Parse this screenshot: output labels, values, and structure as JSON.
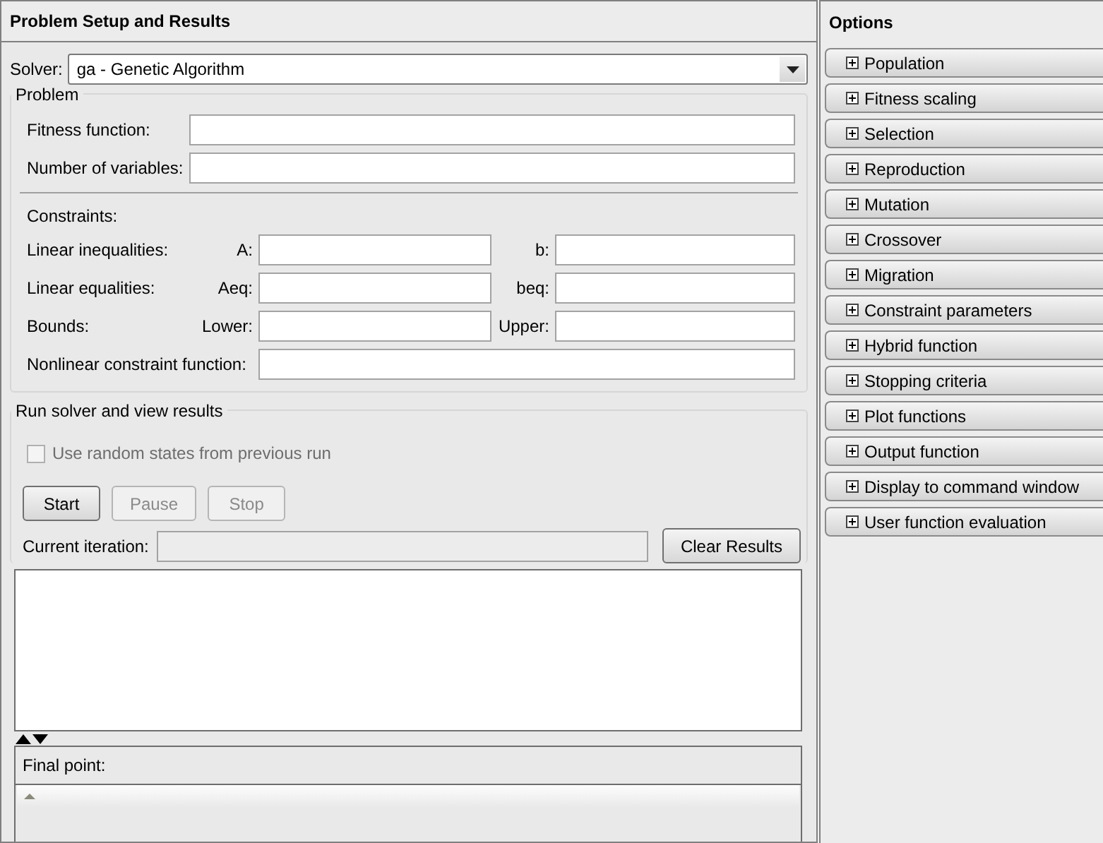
{
  "left_panel": {
    "title": "Problem Setup and Results",
    "solver": {
      "label": "Solver:",
      "value": "ga - Genetic Algorithm"
    },
    "problem": {
      "title": "Problem",
      "fields": [
        {
          "label": "Fitness function:"
        },
        {
          "label": "Number of variables:"
        }
      ]
    },
    "constraints": {
      "title": "Constraints:",
      "rows": [
        {
          "label": "Linear inequalities:",
          "left_label": "A:",
          "right_label": "b:"
        },
        {
          "label": "Linear equalities:",
          "left_label": "Aeq:",
          "right_label": "beq:"
        },
        {
          "label": "Bounds:",
          "left_label": "Lower:",
          "right_label": "Upper:"
        }
      ],
      "nonlinear": {
        "label": "Nonlinear constraint function:"
      }
    },
    "run": {
      "title": "Run solver and view results",
      "checkbox": {
        "label": "Use random states from previous run",
        "checked": false,
        "disabled": true
      },
      "buttons": [
        {
          "label": "Start",
          "disabled": false
        },
        {
          "label": "Pause",
          "disabled": true
        },
        {
          "label": "Stop",
          "disabled": true
        }
      ],
      "iteration": {
        "label": "Current iteration:",
        "disabled": true
      },
      "clear_button": "Clear Results"
    },
    "final_point": {
      "label": "Final point:"
    }
  },
  "options": {
    "title": "Options",
    "sections": [
      {
        "label": "Population",
        "expanded": false
      },
      {
        "label": "Fitness scaling",
        "expanded": false
      },
      {
        "label": "Selection",
        "expanded": false
      },
      {
        "label": "Reproduction",
        "expanded": false
      },
      {
        "label": "Mutation",
        "expanded": false
      },
      {
        "label": "Crossover",
        "expanded": false
      },
      {
        "label": "Migration",
        "expanded": false
      },
      {
        "label": "Constraint parameters",
        "expanded": false
      },
      {
        "label": "Hybrid function",
        "expanded": false
      },
      {
        "label": "Stopping criteria",
        "expanded": false
      },
      {
        "label": "Plot functions",
        "expanded": false
      },
      {
        "label": "Output function",
        "expanded": false
      },
      {
        "label": "Display to command window",
        "expanded": false
      },
      {
        "label": "User function evaluation",
        "expanded": false
      }
    ]
  }
}
